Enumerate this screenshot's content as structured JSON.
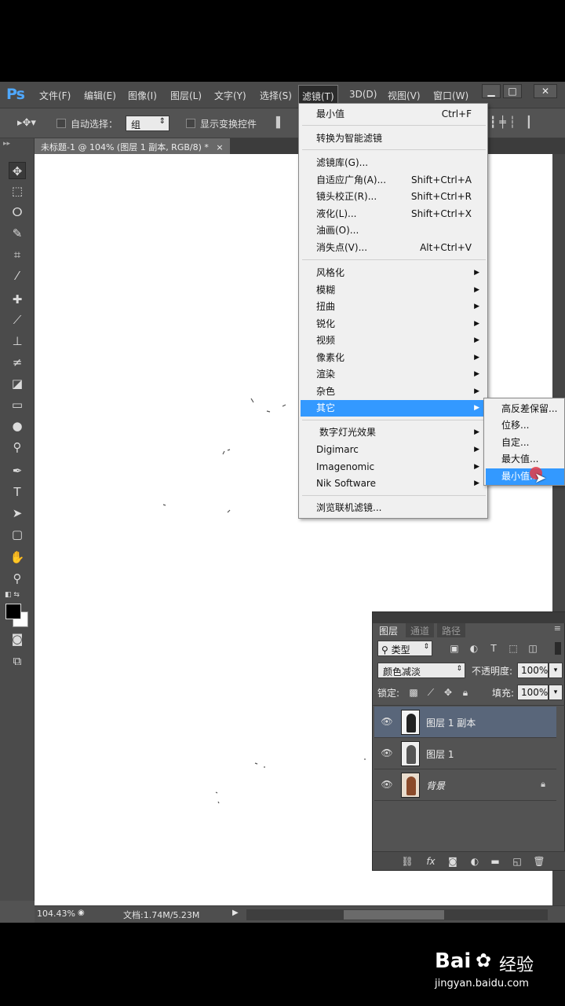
{
  "app": {
    "logo": "Ps"
  },
  "menubar": {
    "items": [
      "文件(F)",
      "编辑(E)",
      "图像(I)",
      "图层(L)",
      "文字(Y)",
      "选择(S)",
      "滤镜(T)",
      "3D(D)",
      "视图(V)",
      "窗口(W)"
    ],
    "active_index": 6,
    "window_controls": [
      "▁",
      "□",
      "✕"
    ]
  },
  "options_bar": {
    "auto_select_label": "自动选择：",
    "auto_select_value": "组",
    "show_transform_label": "显示变换控件"
  },
  "document_tab": {
    "title": "未标题-1 @ 104% (图层 1 副本, RGB/8) *",
    "close": "×"
  },
  "filter_menu": {
    "items": [
      {
        "label": "最小值",
        "shortcut": "Ctrl+F"
      },
      {
        "label": "转换为智能滤镜",
        "shortcut": ""
      },
      {
        "label": "滤镜库(G)...",
        "shortcut": ""
      },
      {
        "label": "自适应广角(A)...",
        "shortcut": "Shift+Ctrl+A"
      },
      {
        "label": "镜头校正(R)...",
        "shortcut": "Shift+Ctrl+R"
      },
      {
        "label": "液化(L)...",
        "shortcut": "Shift+Ctrl+X"
      },
      {
        "label": "油画(O)...",
        "shortcut": ""
      },
      {
        "label": "消失点(V)...",
        "shortcut": "Alt+Ctrl+V"
      },
      {
        "label": "风格化",
        "shortcut": ""
      },
      {
        "label": "模糊",
        "shortcut": ""
      },
      {
        "label": "扭曲",
        "shortcut": ""
      },
      {
        "label": "锐化",
        "shortcut": ""
      },
      {
        "label": "视频",
        "shortcut": ""
      },
      {
        "label": "像素化",
        "shortcut": ""
      },
      {
        "label": "渲染",
        "shortcut": ""
      },
      {
        "label": "杂色",
        "shortcut": ""
      },
      {
        "label": "其它",
        "shortcut": ""
      },
      {
        "label": "数字灯光效果",
        "shortcut": ""
      },
      {
        "label": "Digimarc",
        "shortcut": ""
      },
      {
        "label": "Imagenomic",
        "shortcut": ""
      },
      {
        "label": "Nik Software",
        "shortcut": ""
      },
      {
        "label": "浏览联机滤镜...",
        "shortcut": ""
      }
    ],
    "highlighted_index": 16
  },
  "submenu_other": {
    "items": [
      "高反差保留...",
      "位移...",
      "自定...",
      "最大值...",
      "最小值..."
    ],
    "highlighted_index": 4
  },
  "layers_panel": {
    "tabs": [
      "图层",
      "通道",
      "路径"
    ],
    "filter_kind": "类型",
    "blend_mode": "颜色减淡",
    "opacity_label": "不透明度:",
    "opacity_value": "100%",
    "lock_label": "锁定:",
    "fill_label": "填充:",
    "fill_value": "100%",
    "layers": [
      {
        "name": "图层 1 副本",
        "selected": true
      },
      {
        "name": "图层 1",
        "selected": false
      },
      {
        "name": "背景",
        "selected": false,
        "locked": true
      }
    ]
  },
  "status_bar": {
    "zoom": "104.43%",
    "doc_size": "文档:1.74M/5.23M"
  },
  "watermark": {
    "brand": "Bai",
    "brand2": "经验",
    "url": "jingyan.baidu.com"
  },
  "colors": {
    "accent": "#3399ff",
    "ps_blue": "#4fa8ff",
    "panel": "#535353"
  }
}
